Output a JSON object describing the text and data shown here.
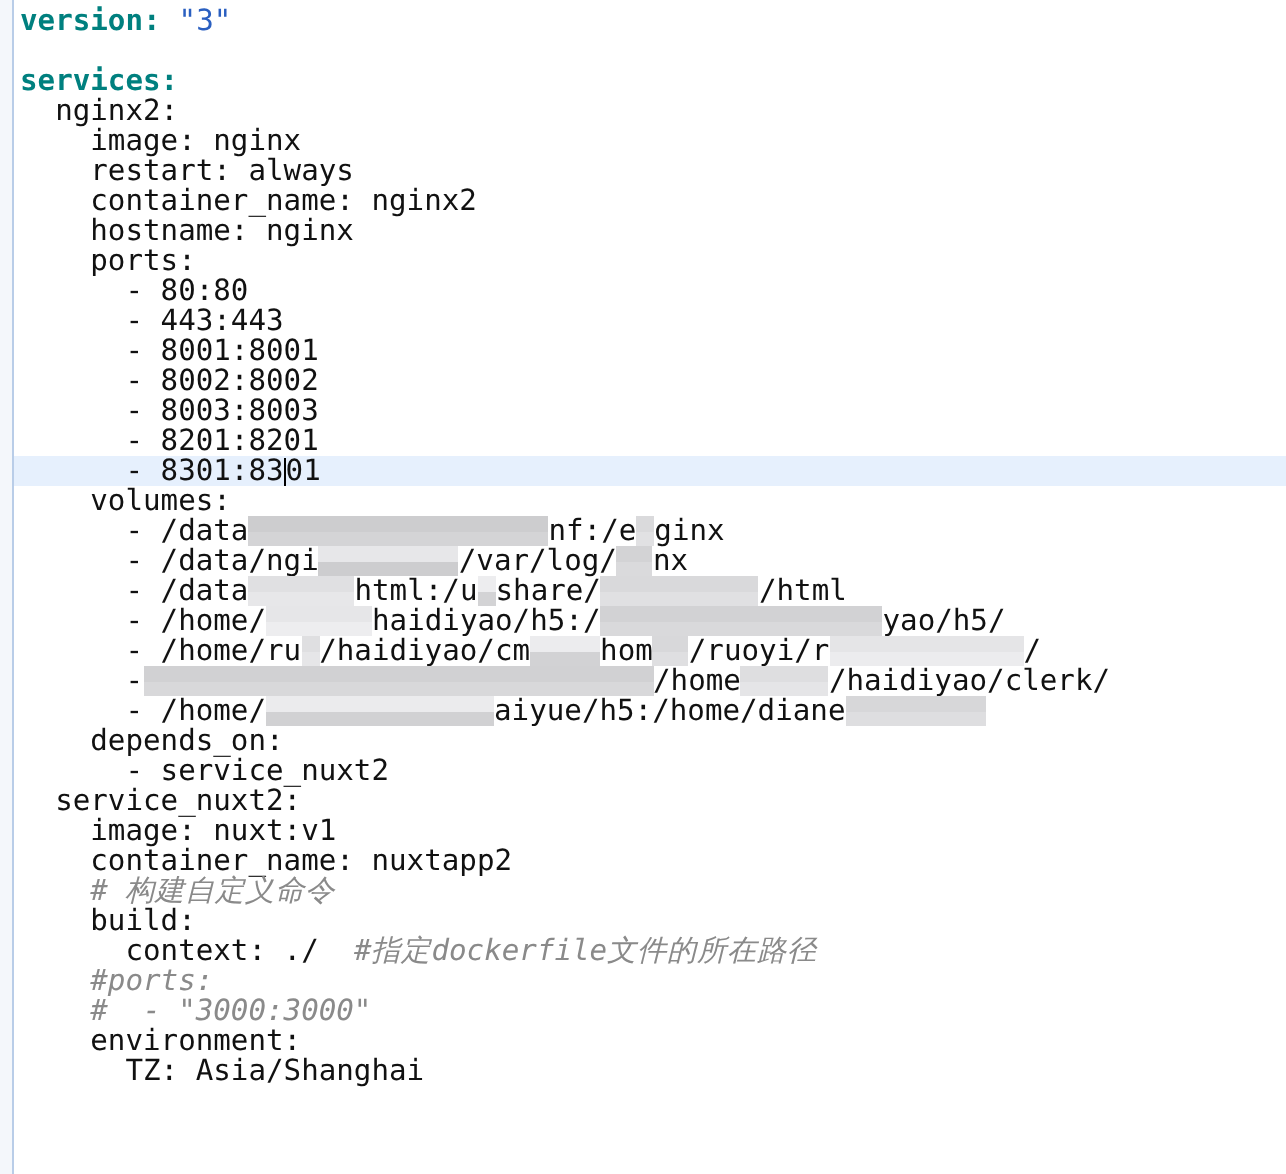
{
  "editor": {
    "lines": [
      {
        "selected": false,
        "spans": [
          {
            "kind": "top-key",
            "text": "version:"
          },
          {
            "kind": "string",
            "text": "\"3\""
          }
        ]
      },
      {
        "selected": false
      },
      {
        "selected": false,
        "spans": [
          {
            "kind": "top-key",
            "text": "services:"
          }
        ]
      },
      {
        "selected": false,
        "spans": [
          {
            "kind": "plain",
            "text": "  nginx2:"
          }
        ]
      },
      {
        "selected": false,
        "spans": [
          {
            "kind": "plain",
            "text": "    image: nginx"
          }
        ]
      },
      {
        "selected": false,
        "spans": [
          {
            "kind": "plain",
            "text": "    restart: always"
          }
        ]
      },
      {
        "selected": false,
        "spans": [
          {
            "kind": "plain",
            "text": "    container_name: nginx2"
          }
        ]
      },
      {
        "selected": false,
        "spans": [
          {
            "kind": "plain",
            "text": "    hostname: nginx"
          }
        ]
      },
      {
        "selected": false,
        "spans": [
          {
            "kind": "plain",
            "text": "    ports:"
          }
        ]
      },
      {
        "selected": false,
        "spans": [
          {
            "kind": "plain",
            "text": "      - 80:80"
          }
        ]
      },
      {
        "selected": false,
        "spans": [
          {
            "kind": "plain",
            "text": "      - 443:443"
          }
        ]
      },
      {
        "selected": false,
        "spans": [
          {
            "kind": "plain",
            "text": "      - 8001:8001"
          }
        ]
      },
      {
        "selected": false,
        "spans": [
          {
            "kind": "plain",
            "text": "      - 8002:8002"
          }
        ]
      },
      {
        "selected": false,
        "spans": [
          {
            "kind": "plain",
            "text": "      - 8003:8003"
          }
        ]
      },
      {
        "selected": false,
        "spans": [
          {
            "kind": "plain",
            "text": "      - 8201:8201"
          }
        ]
      },
      {
        "selected": true,
        "spans": [
          {
            "kind": "plain",
            "text": "      - 8301:83"
          },
          {
            "kind": "caret"
          },
          {
            "kind": "plain",
            "text": "01"
          }
        ]
      },
      {
        "selected": false,
        "spans": [
          {
            "kind": "plain",
            "text": "    volumes:"
          }
        ]
      },
      {
        "selected": false,
        "spans": [
          {
            "kind": "plain",
            "text": "      - /data"
          },
          {
            "kind": "blur"
          },
          {
            "kind": "plain",
            "text": "nf:/e"
          },
          {
            "kind": "blur"
          },
          {
            "kind": "plain",
            "text": "ginx"
          }
        ]
      },
      {
        "selected": false,
        "spans": [
          {
            "kind": "plain",
            "text": "      - /data/ngi"
          },
          {
            "kind": "blur"
          },
          {
            "kind": "plain",
            "text": "/var/log/"
          },
          {
            "kind": "blur"
          },
          {
            "kind": "plain",
            "text": "nx"
          }
        ]
      },
      {
        "selected": false,
        "spans": [
          {
            "kind": "plain",
            "text": "      - /data"
          },
          {
            "kind": "blur"
          },
          {
            "kind": "plain",
            "text": "html:/u"
          },
          {
            "kind": "blur"
          },
          {
            "kind": "plain",
            "text": "share/"
          },
          {
            "kind": "blur"
          },
          {
            "kind": "plain",
            "text": "/html"
          }
        ]
      },
      {
        "selected": false,
        "spans": [
          {
            "kind": "plain",
            "text": "      - /home/"
          },
          {
            "kind": "blur"
          },
          {
            "kind": "plain",
            "text": "haidiyao/h5:/"
          },
          {
            "kind": "blur"
          },
          {
            "kind": "plain",
            "text": "yao/h5/"
          }
        ]
      },
      {
        "selected": false,
        "spans": [
          {
            "kind": "plain",
            "text": "      - /home/ru"
          },
          {
            "kind": "blur"
          },
          {
            "kind": "plain",
            "text": "/haidiyao/cm"
          },
          {
            "kind": "blur"
          },
          {
            "kind": "plain",
            "text": "hom"
          },
          {
            "kind": "blur"
          },
          {
            "kind": "plain",
            "text": "/ruoyi/r"
          },
          {
            "kind": "blur"
          },
          {
            "kind": "plain",
            "text": "/"
          }
        ]
      },
      {
        "selected": false,
        "spans": [
          {
            "kind": "plain",
            "text": "      -"
          },
          {
            "kind": "blur"
          },
          {
            "kind": "plain",
            "text": "/home"
          },
          {
            "kind": "blur"
          },
          {
            "kind": "plain",
            "text": "/haidiyao/clerk/"
          }
        ]
      },
      {
        "selected": false,
        "spans": [
          {
            "kind": "plain",
            "text": "      - /home/"
          },
          {
            "kind": "blur"
          },
          {
            "kind": "plain",
            "text": "aiyue/h5:/home/diane"
          },
          {
            "kind": "blur"
          }
        ]
      },
      {
        "selected": false,
        "spans": [
          {
            "kind": "plain",
            "text": "    depends_on:"
          }
        ]
      },
      {
        "selected": false,
        "spans": [
          {
            "kind": "plain",
            "text": "      - service_nuxt2"
          }
        ]
      },
      {
        "selected": false,
        "spans": [
          {
            "kind": "plain",
            "text": "  service_nuxt2:"
          }
        ]
      },
      {
        "selected": false,
        "spans": [
          {
            "kind": "plain",
            "text": "    image: nuxt:v1"
          }
        ]
      },
      {
        "selected": false,
        "spans": [
          {
            "kind": "plain",
            "text": "    container_name: nuxtapp2"
          }
        ]
      },
      {
        "selected": false,
        "spans": [
          {
            "kind": "comment",
            "text": "    # 构建自定义命令"
          }
        ]
      },
      {
        "selected": false,
        "spans": [
          {
            "kind": "plain",
            "text": "    build:"
          }
        ]
      },
      {
        "selected": false,
        "spans": [
          {
            "kind": "plain",
            "text": "      context: ./  "
          },
          {
            "kind": "comment",
            "text": "#指定dockerfile文件的所在路径"
          }
        ]
      },
      {
        "selected": false,
        "spans": [
          {
            "kind": "comment",
            "text": "    #ports:"
          }
        ]
      },
      {
        "selected": false,
        "spans": [
          {
            "kind": "comment",
            "text": "    #  - \"3000:3000\""
          }
        ]
      },
      {
        "selected": false,
        "spans": [
          {
            "kind": "plain",
            "text": "    environment:"
          }
        ]
      },
      {
        "selected": false,
        "spans": [
          {
            "kind": "plain",
            "text": "      TZ: Asia/Shanghai"
          }
        ]
      },
      {
        "selected": false
      }
    ]
  }
}
